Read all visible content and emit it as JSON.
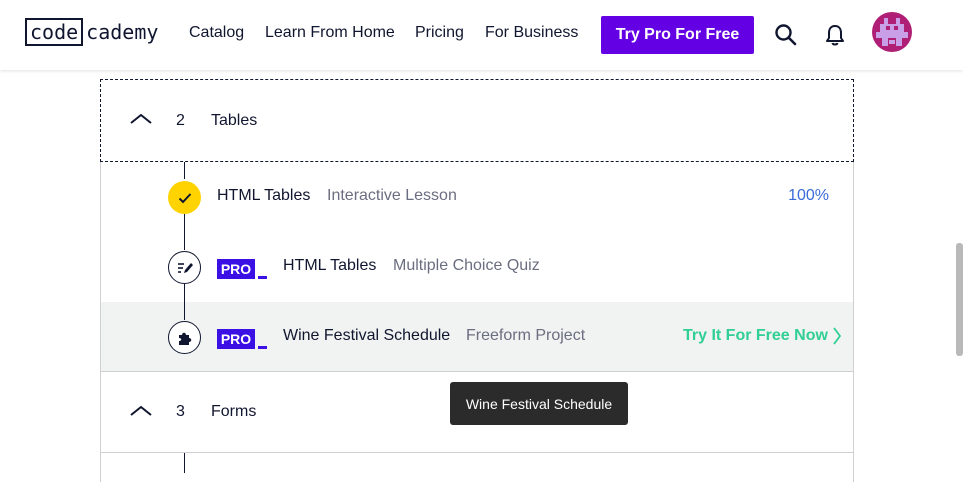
{
  "header": {
    "logo_code": "code",
    "logo_rest": "cademy",
    "nav": [
      "Catalog",
      "Learn From Home",
      "Pricing",
      "For Business"
    ],
    "cta_label": "Try Pro For Free",
    "icons": [
      "search-icon",
      "bell-icon"
    ]
  },
  "modules": [
    {
      "number": "2",
      "title": "Tables",
      "items": [
        {
          "title": "HTML Tables",
          "type": "Interactive Lesson",
          "status": "completed",
          "progress": "100%",
          "pro": false
        },
        {
          "title": "HTML Tables",
          "type": "Multiple Choice Quiz",
          "status": "locked",
          "pro": true,
          "pro_label": "PRO"
        },
        {
          "title": "Wine Festival Schedule",
          "type": "Freeform Project",
          "status": "locked",
          "pro": true,
          "pro_label": "PRO",
          "action": "Try It For Free Now"
        }
      ]
    },
    {
      "number": "3",
      "title": "Forms"
    }
  ],
  "tooltip": "Wine Festival Schedule",
  "colors": {
    "brand_purple": "#6400e4",
    "pro_blue": "#3a10e5",
    "done_yellow": "#ffd300",
    "progress_blue": "#3a6bd8",
    "try_green": "#2fcf95",
    "avatar": "#b01f76"
  }
}
